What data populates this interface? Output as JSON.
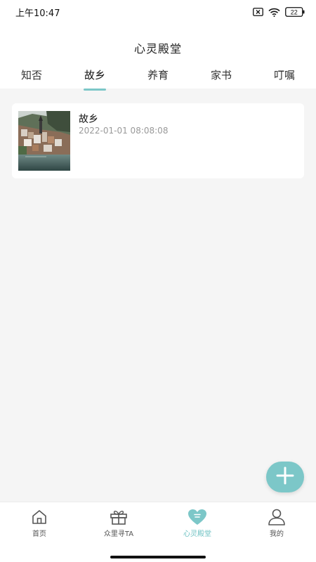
{
  "status_bar": {
    "time": "上午10:47",
    "battery": "22"
  },
  "header": {
    "title": "心灵殿堂"
  },
  "tabs": [
    {
      "label": "知否",
      "active": false
    },
    {
      "label": "故乡",
      "active": true
    },
    {
      "label": "养育",
      "active": false
    },
    {
      "label": "家书",
      "active": false
    },
    {
      "label": "叮嘱",
      "active": false
    }
  ],
  "cards": [
    {
      "title": "故乡",
      "date": "2022-01-01 08:08:08",
      "thumbnail": "village-photo"
    }
  ],
  "fab": {
    "icon": "plus-icon"
  },
  "bottom_nav": [
    {
      "label": "首页",
      "icon": "home-icon",
      "active": false
    },
    {
      "label": "众里寻TA",
      "icon": "gift-icon",
      "active": false
    },
    {
      "label": "心灵殿堂",
      "icon": "heart-icon",
      "active": true
    },
    {
      "label": "我的",
      "icon": "person-icon",
      "active": false
    }
  ],
  "colors": {
    "accent": "#7cc7c8",
    "background": "#f5f5f5",
    "card": "#ffffff"
  }
}
